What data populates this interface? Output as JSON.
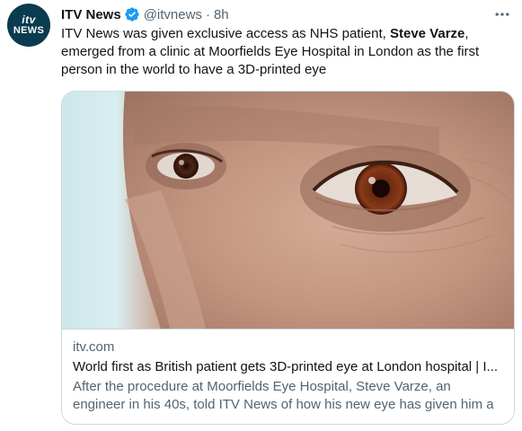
{
  "author": {
    "avatar_line1": "itv",
    "avatar_line2": "NEWS",
    "name": "ITV News",
    "handle": "@itvnews",
    "separator": "·",
    "time": "8h"
  },
  "tweet": {
    "text_part1": "ITV News was given exclusive access as NHS patient, ",
    "text_bold": "Steve Varze",
    "text_part2": ", emerged from a clinic at Moorfields Eye Hospital in London as the first person in the world to have a 3D-printed eye"
  },
  "card": {
    "domain": "itv.com",
    "title": "World first as British patient gets 3D-printed eye at London hospital | I...",
    "description": "After the procedure at Moorfields Eye Hospital, Steve Varze, an engineer in his 40s, told ITV News of how his new eye has given him a ..."
  },
  "colors": {
    "verified": "#1d9bf0",
    "text_primary": "#0f1419",
    "text_secondary": "#536471",
    "border": "#cfd9de",
    "avatar_bg": "#0b3b4e"
  },
  "icons": {
    "verified": "verified-badge",
    "more": "more-horizontal"
  }
}
